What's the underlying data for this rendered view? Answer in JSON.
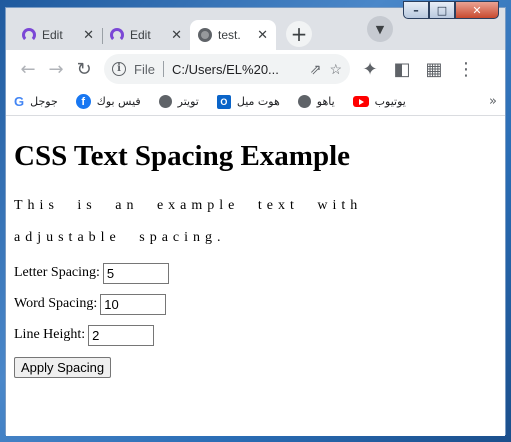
{
  "tabs": [
    {
      "label": "Edit",
      "favicon": "purple-ring-icon",
      "active": false
    },
    {
      "label": "Edit",
      "favicon": "purple-ring-icon",
      "active": false
    },
    {
      "label": "test.",
      "favicon": "globe-icon",
      "active": true
    }
  ],
  "toolbar": {
    "file_label": "File",
    "url": "C:/Users/EL%20..."
  },
  "bookmarks": [
    {
      "label": "جوجل",
      "icon": "google-icon"
    },
    {
      "label": "فيس بوك",
      "icon": "facebook-icon"
    },
    {
      "label": "تويتر",
      "icon": "globe-icon"
    },
    {
      "label": "هوت ميل",
      "icon": "outlook-icon"
    },
    {
      "label": "ياهو",
      "icon": "globe-icon"
    },
    {
      "label": "يوتيوب",
      "icon": "youtube-icon"
    }
  ],
  "page": {
    "title": "CSS Text Spacing Example",
    "sample_text": "This is an example text with adjustable spacing.",
    "letter_spacing_label": "Letter Spacing:",
    "letter_spacing_value": "5",
    "word_spacing_label": "Word Spacing:",
    "word_spacing_value": "10",
    "line_height_label": "Line Height:",
    "line_height_value": "2",
    "apply_button": "Apply Spacing"
  }
}
